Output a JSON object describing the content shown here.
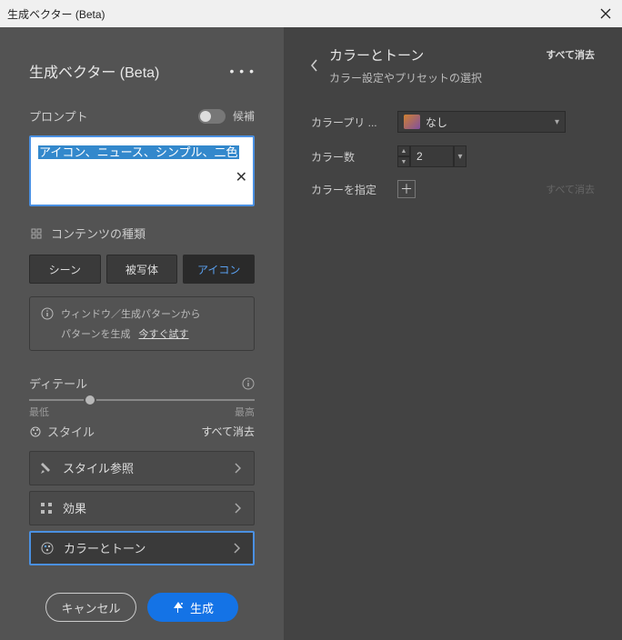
{
  "window": {
    "title": "生成ベクター (Beta)"
  },
  "panel": {
    "title": "生成ベクター (Beta)",
    "menu_glyph": "• • •",
    "prompt_label": "プロンプト",
    "toggle_label": "候補",
    "prompt_value": "アイコン、ニュース、シンプル、二色",
    "content_type_label": "コンテンツの種類",
    "types": {
      "scene": "シーン",
      "subject": "被写体",
      "icon": "アイコン"
    },
    "info_line1": "ウィンドウ／生成パターンから",
    "info_line2": "パターンを生成",
    "info_link": "今すぐ試す",
    "detail_label": "ディテール",
    "slider_min": "最低",
    "slider_max": "最高",
    "style_label": "スタイル",
    "clear_all": "すべて消去",
    "nav": {
      "style_ref": "スタイル参照",
      "effects": "効果",
      "color_tone": "カラーとトーン"
    },
    "cancel": "キャンセル",
    "generate": "生成"
  },
  "right": {
    "title": "カラーとトーン",
    "subtitle": "カラー設定やプリセットの選択",
    "clear_all": "すべて消去",
    "preset_label": "カラープリ ...",
    "preset_value": "なし",
    "count_label": "カラー数",
    "count_value": "2",
    "specify_label": "カラーを指定",
    "specify_clear": "すべて消去"
  }
}
